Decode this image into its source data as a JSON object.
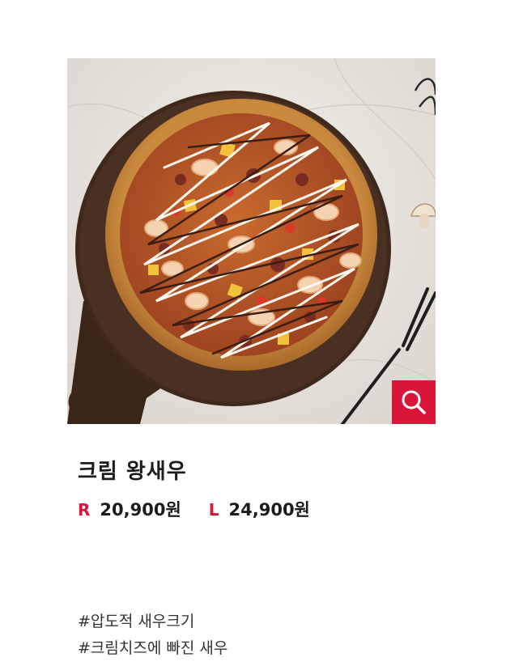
{
  "product": {
    "title": "크림 왕새우",
    "image_icon": "pizza-photo",
    "zoom_icon": "search-icon",
    "accent_color": "#d9153a"
  },
  "prices": [
    {
      "size": "R",
      "amount": "20,900원"
    },
    {
      "size": "L",
      "amount": "24,900원"
    }
  ],
  "hashtags": [
    "#압도적 새우크기",
    "#크림치즈에 빠진 새우"
  ]
}
